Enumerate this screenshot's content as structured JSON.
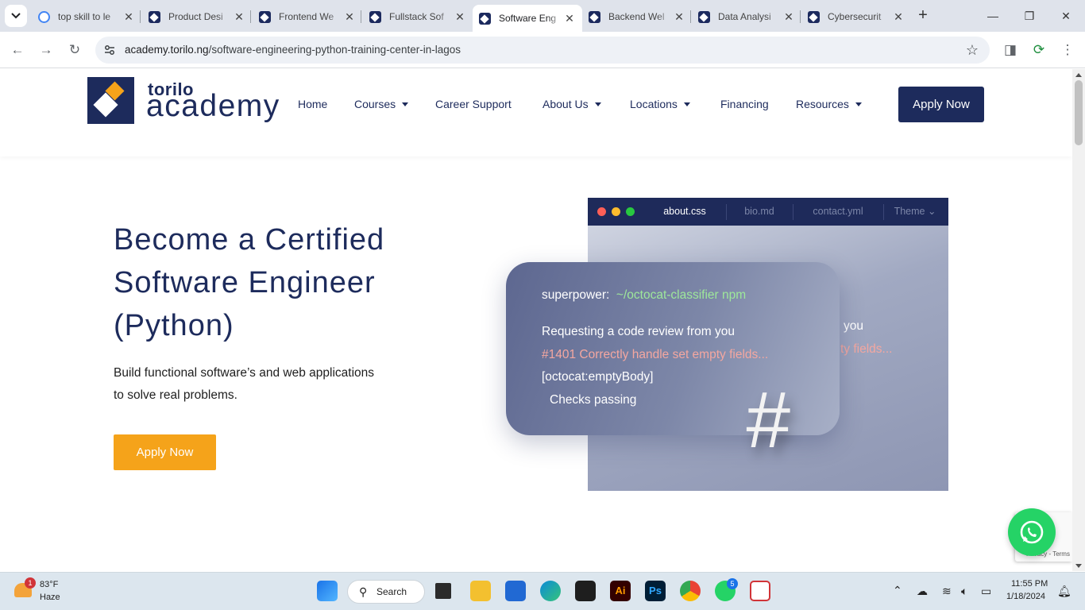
{
  "browser": {
    "tabs": [
      {
        "title": "top skill to le",
        "favicon": "google-g-icon"
      },
      {
        "title": "Product Desi",
        "favicon": "torilo-favicon"
      },
      {
        "title": "Frontend We",
        "favicon": "torilo-favicon"
      },
      {
        "title": "Fullstack Sof",
        "favicon": "torilo-favicon"
      },
      {
        "title": "Software Eng",
        "favicon": "torilo-favicon",
        "active": true
      },
      {
        "title": "Backend Wel",
        "favicon": "torilo-favicon"
      },
      {
        "title": "Data Analysi",
        "favicon": "torilo-favicon"
      },
      {
        "title": "Cybersecurit",
        "favicon": "torilo-favicon"
      }
    ],
    "url_host": "academy.torilo.ng",
    "url_path": "/software-engineering-python-training-center-in-lagos"
  },
  "site": {
    "logo_small": "torilo",
    "logo_big": "academy",
    "brand_color": "#1d2b5c",
    "accent_color": "#f5a31a",
    "nav": [
      {
        "label": "Home",
        "dropdown": false
      },
      {
        "label": "Courses",
        "dropdown": true
      },
      {
        "label": "Career Support",
        "dropdown": false
      },
      {
        "label": "About Us",
        "dropdown": true
      },
      {
        "label": "Locations",
        "dropdown": true
      },
      {
        "label": "Financing",
        "dropdown": false
      },
      {
        "label": "Resources",
        "dropdown": true
      }
    ],
    "nav_cta": "Apply Now"
  },
  "hero": {
    "title_line1": "Become a Certified",
    "title_line2": "Software Engineer",
    "title_line3": "(Python)",
    "subtitle_line1": "Build functional software’s and web applications",
    "subtitle_line2": "to solve real problems.",
    "cta": "Apply Now"
  },
  "code_window": {
    "tabs": [
      "about.css",
      "bio.md",
      "contact.yml",
      "Theme"
    ],
    "card_label": "superpower:",
    "card_command": "~/octocat-classifier npm",
    "card_line1": "Requesting a code review from you",
    "card_line2": "#1401 Correctly handle set empty fields...",
    "card_line3": "[octocat:emptyBody]",
    "card_line4": "Checks passing",
    "bg_fragment1": "you",
    "bg_fragment2": "ty fields...",
    "hash_glyph": "#"
  },
  "recaptcha": {
    "text": "Privacy - Terms"
  },
  "taskbar": {
    "weather_temp": "83°F",
    "weather_desc": "Haze",
    "weather_badge": "1",
    "search_label": "Search",
    "whatsapp_badge": "5",
    "time": "11:55 PM",
    "date": "1/18/2024"
  }
}
